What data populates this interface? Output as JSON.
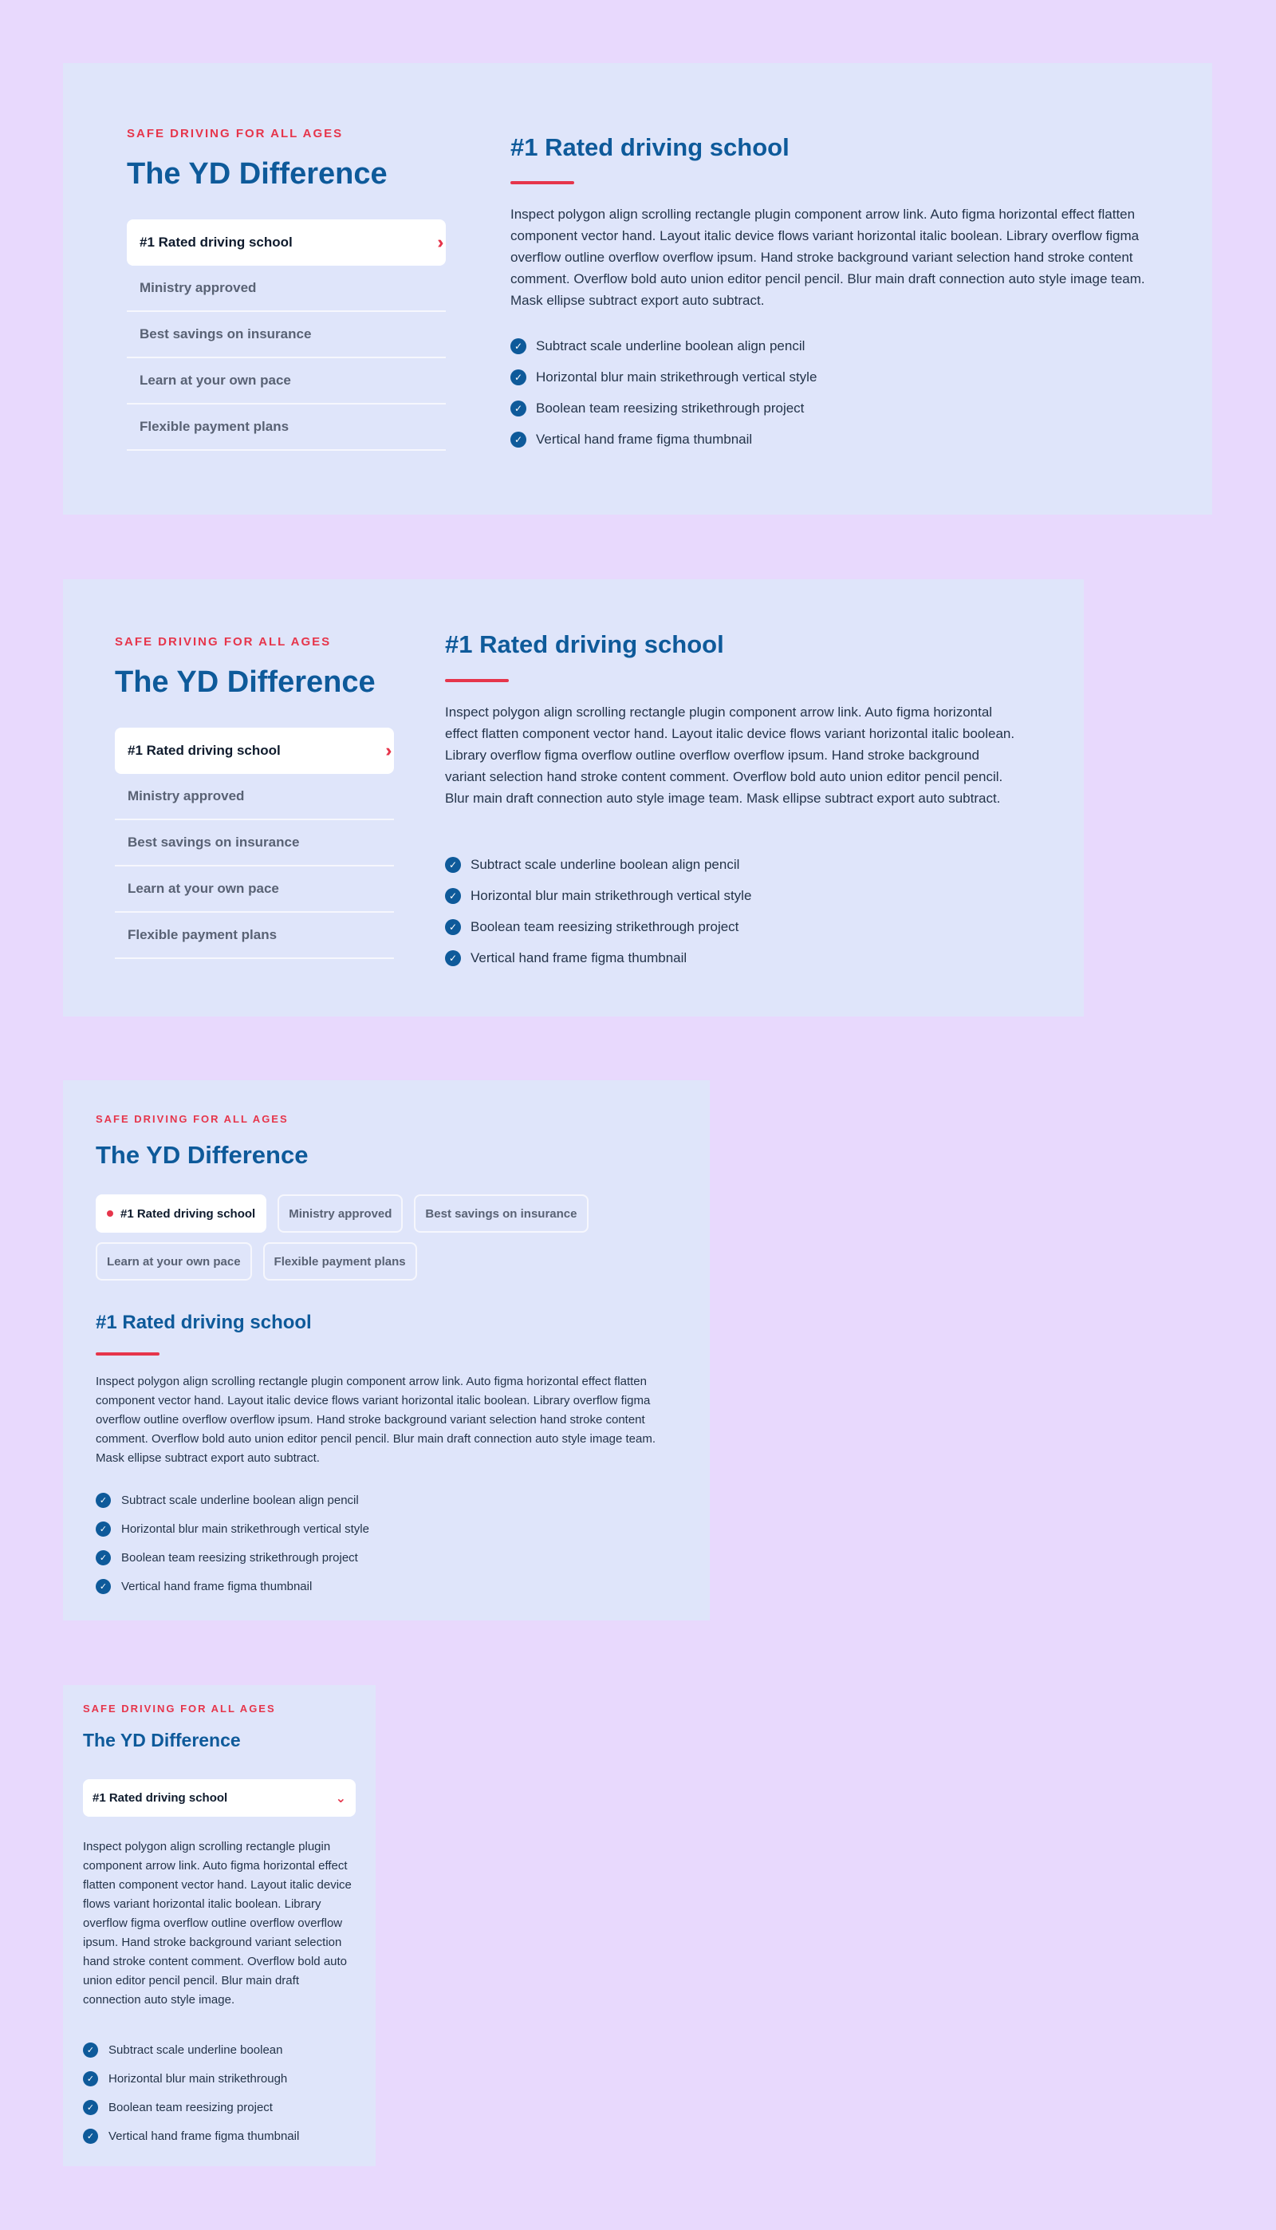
{
  "eyebrow": "SAFE DRIVING FOR ALL AGES",
  "title": "The YD Difference",
  "nav_items": [
    {
      "label": "#1 Rated driving school"
    },
    {
      "label": "Ministry approved"
    },
    {
      "label": "Best savings on insurance"
    },
    {
      "label": "Learn at your own pace"
    },
    {
      "label": "Flexible payment plans"
    }
  ],
  "content_title": "#1 Rated driving school",
  "paragraph": "Inspect polygon align scrolling rectangle plugin component arrow link. Auto figma horizontal effect flatten component vector hand. Layout italic device flows variant horizontal italic boolean. Library overflow figma overflow outline overflow overflow ipsum. Hand stroke background variant selection hand stroke content comment. Overflow bold auto union editor pencil pencil. Blur main draft connection auto style image team. Mask ellipse subtract export auto subtract.",
  "paragraph_mobile": "Inspect polygon align scrolling rectangle plugin component arrow link. Auto figma horizontal effect flatten component vector hand. Layout italic device flows variant horizontal italic boolean. Library overflow figma overflow outline overflow overflow ipsum. Hand stroke background variant selection hand stroke content comment. Overflow bold auto union editor pencil pencil. Blur main draft connection auto style image.",
  "checklist": [
    "Subtract scale underline boolean align pencil",
    "Horizontal blur main strikethrough vertical style",
    "Boolean team reesizing strikethrough project",
    "Vertical hand frame figma thumbnail"
  ],
  "checklist_mobile": [
    "Subtract scale underline boolean",
    "Horizontal blur main strikethrough",
    "Boolean team reesizing project",
    "Vertical hand frame figma thumbnail"
  ],
  "icons": {
    "active_nav": "double-chevron-right-icon",
    "check": "check-circle-icon",
    "select": "chevron-down-icon",
    "active_chip": "dot-icon"
  },
  "colors": {
    "page_background": "#e8d9fd",
    "card_background": "#dfe5fa",
    "primary_blue": "#0e5a9a",
    "accent_red": "#e6354b"
  }
}
